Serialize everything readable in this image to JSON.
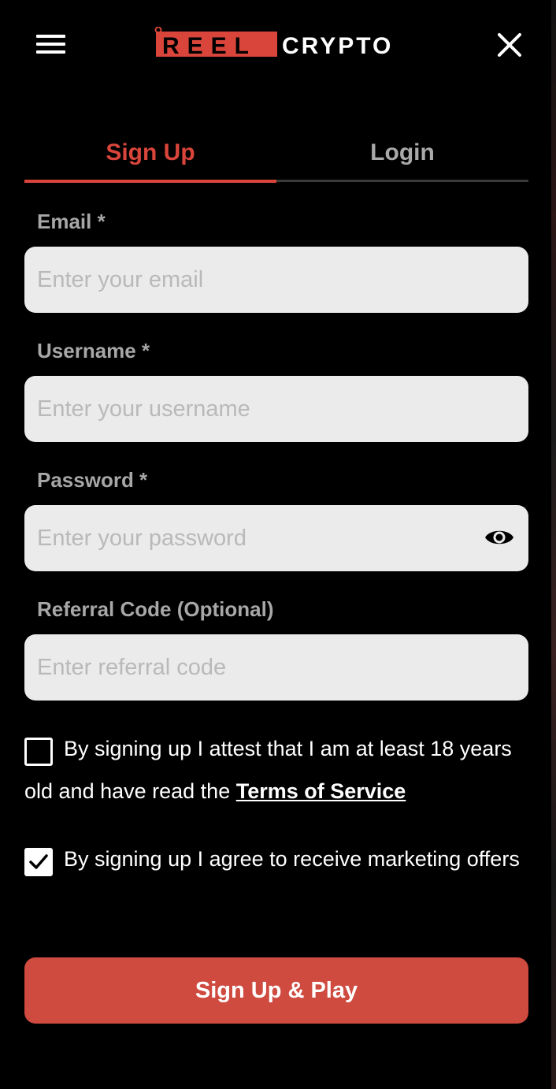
{
  "header": {
    "logo_reel": "REEL",
    "logo_crypto": "CRYPTO",
    "menu_icon": "hamburger-menu-icon",
    "close_icon": "close-x-icon"
  },
  "tabs": [
    {
      "label": "Sign Up",
      "active": true
    },
    {
      "label": "Login",
      "active": false
    }
  ],
  "form": {
    "email": {
      "label": "Email *",
      "placeholder": "Enter your email",
      "value": ""
    },
    "username": {
      "label": "Username *",
      "placeholder": "Enter your username",
      "value": ""
    },
    "password": {
      "label": "Password *",
      "placeholder": "Enter your password",
      "value": "",
      "icon": "eye-icon"
    },
    "referral": {
      "label": "Referral Code (Optional)",
      "placeholder": "Enter referral code",
      "value": ""
    }
  },
  "consent": {
    "age": {
      "checked": false,
      "text": "By signing up I attest that I am at least 18 years old and have read the ",
      "link": "Terms of Service"
    },
    "marketing": {
      "checked": true,
      "text": "By signing up I agree to receive marketing offers"
    }
  },
  "submit_label": "Sign Up & Play",
  "colors": {
    "accent": "#d9453a",
    "button": "#cf4a3f",
    "input_bg": "#ebebeb",
    "label": "#a7a7a7",
    "background": "#000000"
  }
}
